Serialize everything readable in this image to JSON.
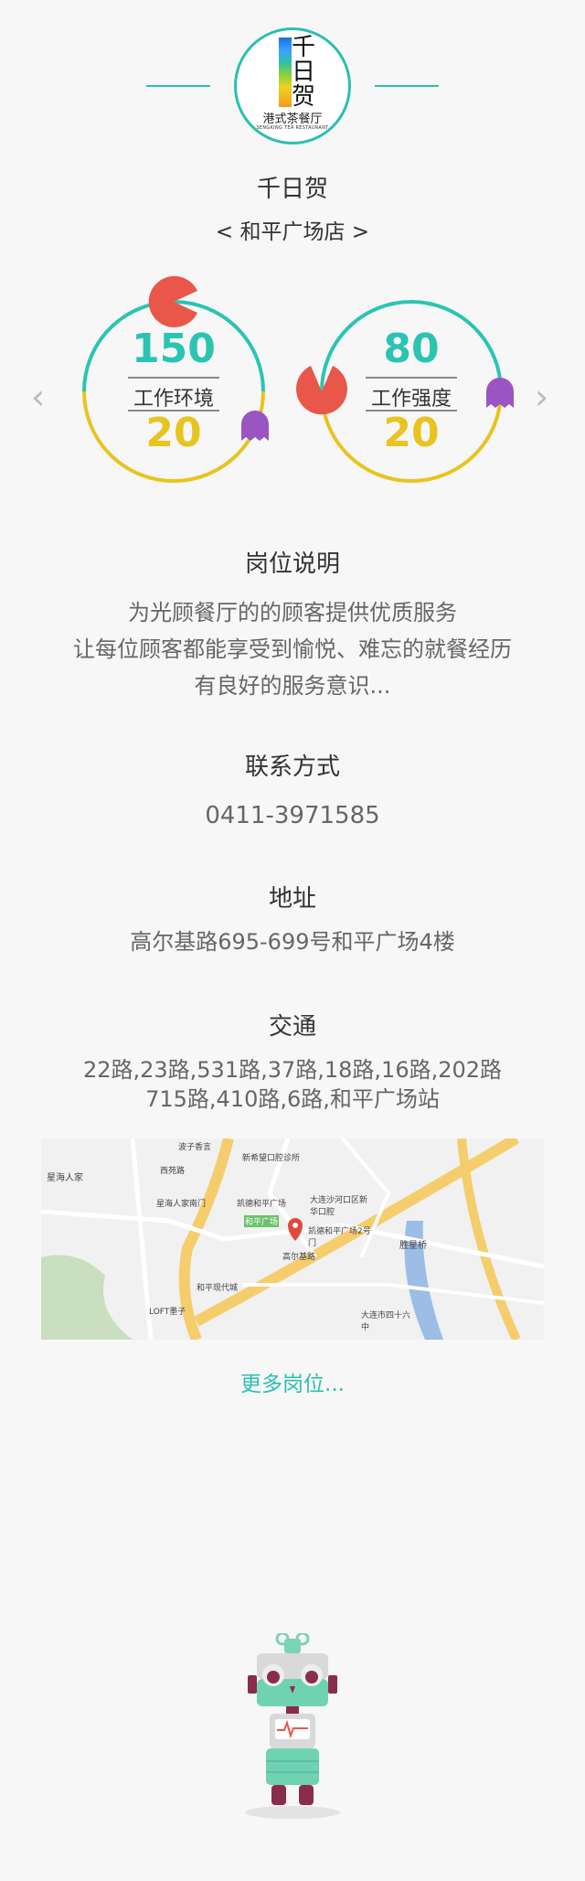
{
  "restaurant": {
    "logo_text": "千日贺",
    "logo_subtitle": "港式茶餐厅",
    "logo_english": "SENGKING TEA RESTAURANT",
    "name": "千日贺",
    "branch": "< 和平广场店 >"
  },
  "gauges": [
    {
      "label": "工作环境",
      "top_value": "150",
      "bottom_value": "20"
    },
    {
      "label": "工作强度",
      "top_value": "80",
      "bottom_value": "20"
    }
  ],
  "nav": {
    "prev": "‹",
    "next": "›"
  },
  "job": {
    "title": "岗位说明",
    "lines": [
      "为光顾餐厅的的顾客提供优质服务",
      "让每位顾客都能享受到愉悦、难忘的就餐经历",
      "有良好的服务意识..."
    ]
  },
  "contact": {
    "title": "联系方式",
    "phone": "0411-3971585"
  },
  "address": {
    "title": "地址",
    "value": "高尔基路695-699号和平广场4楼"
  },
  "transport": {
    "title": "交通",
    "lines": [
      "22路,23路,531路,37路,18路,16路,202路",
      "715路,410路,6路,和平广场站"
    ]
  },
  "map": {
    "labels": [
      "星海人家",
      "新希望口腔诊所",
      "凯德和平广场",
      "星海人家南门",
      "和平广场",
      "大连沙河口区新华口腔",
      "凯德和平广场2号门",
      "和平现代城",
      "高尔基路",
      "胜星桥",
      "LOFT墨子",
      "大连市四十六中",
      "西苑路",
      "波子香言"
    ]
  },
  "more_link": "更多岗位...",
  "colors": {
    "accent": "#2bbfb0",
    "yellow": "#e7c41f",
    "pacman": "#e8574a",
    "ghost": "#9a55c2"
  }
}
